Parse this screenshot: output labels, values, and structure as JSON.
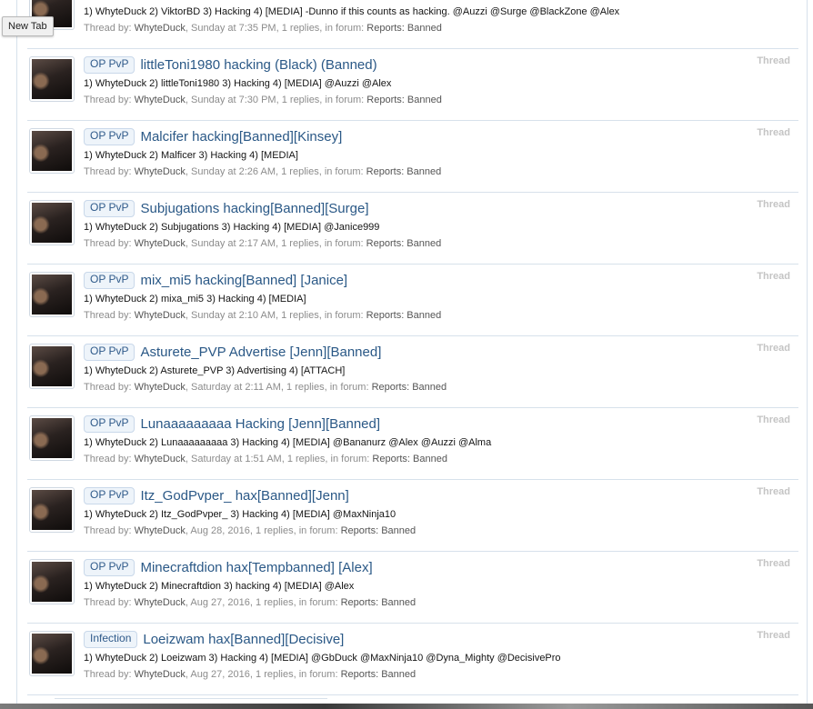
{
  "tooltip": "New Tab",
  "labels": {
    "thread_by": "Thread by:",
    "replies_suffix": "replies, in forum:",
    "type": "Thread"
  },
  "results": [
    {
      "prefix": "",
      "title": "",
      "snippet": "1) WhyteDuck 2) ViktorBD 3) Hacking 4) [MEDIA] -Dunno if this counts as hacking. @Auzzi @Surge @BlackZone @Alex",
      "author": "WhyteDuck",
      "date": "Sunday at 7:35 PM",
      "replies": "1",
      "forum": "Reports: Banned"
    },
    {
      "prefix": "OP PvP",
      "title": "littleToni1980 hacking (Black) (Banned)",
      "snippet": "1) WhyteDuck 2) littleToni1980 3) Hacking 4) [MEDIA] @Auzzi @Alex",
      "author": "WhyteDuck",
      "date": "Sunday at 7:30 PM",
      "replies": "1",
      "forum": "Reports: Banned"
    },
    {
      "prefix": "OP PvP",
      "title": "Malcifer hacking[Banned][Kinsey]",
      "snippet": "1) WhyteDuck 2) Malficer 3) Hacking 4) [MEDIA]",
      "author": "WhyteDuck",
      "date": "Sunday at 2:26 AM",
      "replies": "1",
      "forum": "Reports: Banned"
    },
    {
      "prefix": "OP PvP",
      "title": "Subjugations hacking[Banned][Surge]",
      "snippet": "1) WhyteDuck 2) Subjugations 3) Hacking 4) [MEDIA] @Janice999",
      "author": "WhyteDuck",
      "date": "Sunday at 2:17 AM",
      "replies": "1",
      "forum": "Reports: Banned"
    },
    {
      "prefix": "OP PvP",
      "title": "mix_mi5 hacking[Banned] [Janice]",
      "snippet": "1) WhyteDuck 2) mixa_mi5 3) Hacking 4) [MEDIA]",
      "author": "WhyteDuck",
      "date": "Sunday at 2:10 AM",
      "replies": "1",
      "forum": "Reports: Banned"
    },
    {
      "prefix": "OP PvP",
      "title": "Asturete_PVP Advertise [Jenn][Banned]",
      "snippet": "1) WhyteDuck 2) Asturete_PVP 3) Advertising 4) [ATTACH]",
      "author": "WhyteDuck",
      "date": "Saturday at 2:11 AM",
      "replies": "1",
      "forum": "Reports: Banned"
    },
    {
      "prefix": "OP PvP",
      "title": "Lunaaaaaaaaa Hacking [Jenn][Banned]",
      "snippet": "1) WhyteDuck 2) Lunaaaaaaaaa 3) Hacking 4) [MEDIA] @Bananurz @Alex @Auzzi @Alma",
      "author": "WhyteDuck",
      "date": "Saturday at 1:51 AM",
      "replies": "1",
      "forum": "Reports: Banned"
    },
    {
      "prefix": "OP PvP",
      "title": "Itz_GodPvper_ hax[Banned][Jenn]",
      "snippet": "1) WhyteDuck 2) Itz_GodPvper_ 3) Hacking 4) [MEDIA] @MaxNinja10",
      "author": "WhyteDuck",
      "date": "Aug 28, 2016",
      "replies": "1",
      "forum": "Reports: Banned"
    },
    {
      "prefix": "OP PvP",
      "title": "Minecraftdion hax[Tempbanned] [Alex]",
      "snippet": "1) WhyteDuck 2) Minecraftdion 3) hacking 4) [MEDIA] @Alex",
      "author": "WhyteDuck",
      "date": "Aug 27, 2016",
      "replies": "1",
      "forum": "Reports: Banned"
    },
    {
      "prefix": "Infection",
      "title": "Loeizwam hax[Banned][Decisive]",
      "snippet": "1) WhyteDuck 2) Loeizwam 3) Hacking 4) [MEDIA] @GbDuck @MaxNinja10 @Dyna_Mighty @DecisivePro",
      "author": "WhyteDuck",
      "date": "Aug 27, 2016",
      "replies": "1",
      "forum": "Reports: Banned"
    }
  ]
}
